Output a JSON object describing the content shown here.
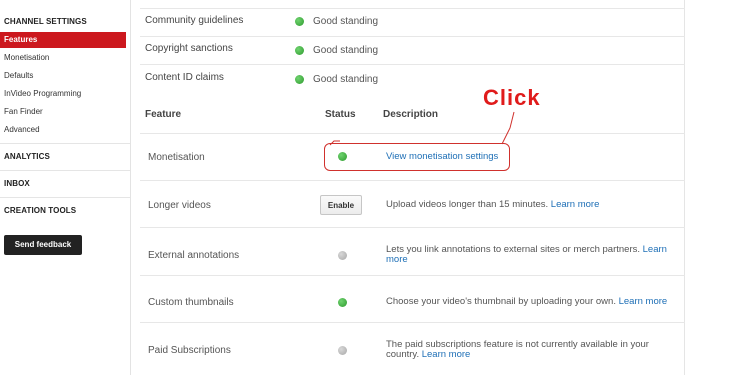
{
  "sidebar": {
    "sections": [
      "CHANNEL SETTINGS",
      "ANALYTICS",
      "INBOX",
      "CREATION TOOLS"
    ],
    "items": [
      "Features",
      "Monetisation",
      "Defaults",
      "InVideo Programming",
      "Fan Finder",
      "Advanced"
    ],
    "active_item": "Features",
    "feedback_button": "Send feedback"
  },
  "standing": [
    {
      "label": "Community guidelines",
      "status": "Good standing"
    },
    {
      "label": "Copyright sanctions",
      "status": "Good standing"
    },
    {
      "label": "Content ID claims",
      "status": "Good standing"
    }
  ],
  "table": {
    "headers": {
      "feature": "Feature",
      "status": "Status",
      "description": "Description"
    },
    "rows": [
      {
        "feature": "Monetisation",
        "status": "green",
        "desc_text": "",
        "desc_link": "View monetisation settings"
      },
      {
        "feature": "Longer videos",
        "status_button": "Enable",
        "desc_text": "Upload videos longer than 15 minutes.",
        "desc_link": "Learn more"
      },
      {
        "feature": "External annotations",
        "status": "grey",
        "desc_text": "Lets you link annotations to external sites or merch partners.",
        "desc_link": "Learn more"
      },
      {
        "feature": "Custom thumbnails",
        "status": "green",
        "desc_text": "Choose your video's thumbnail by uploading your own.",
        "desc_link": "Learn more"
      },
      {
        "feature": "Paid Subscriptions",
        "status": "grey",
        "desc_text": "The paid subscriptions feature is not currently available in your country.",
        "desc_link": "Learn more"
      }
    ]
  },
  "annotation": {
    "text": "Click",
    "color": "#e01b1b"
  },
  "colors": {
    "accent": "#cc181e",
    "link": "#1e6fb6",
    "status_ok": "#2e9a2e",
    "status_off": "#a8a8a8"
  }
}
